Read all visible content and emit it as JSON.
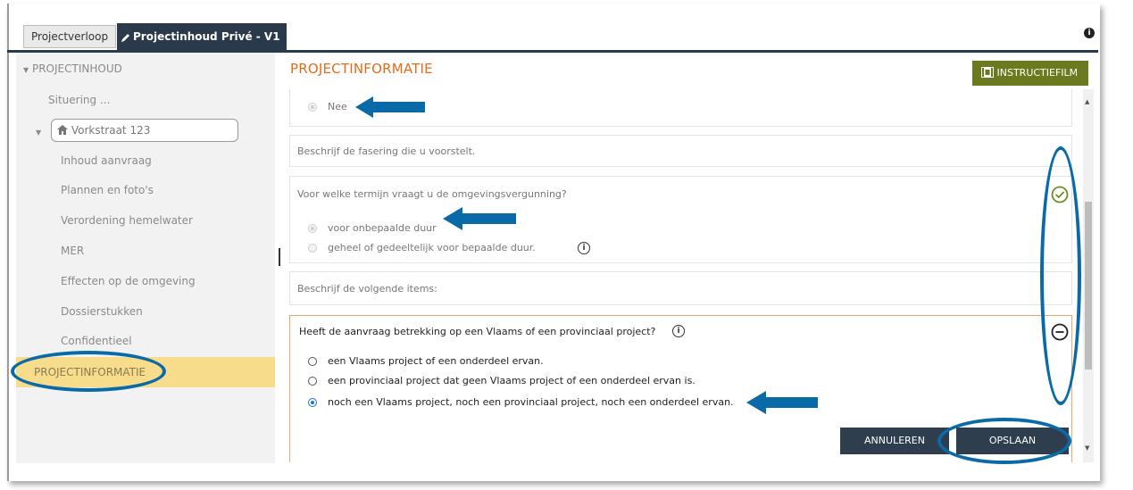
{
  "tabs": {
    "tab1": "Projectverloop",
    "tab2": "Projectinhoud Privé - V1"
  },
  "sidebar": {
    "root": "PROJECTINHOUD",
    "situering": "Situering ...",
    "address": "Vorkstraat 123",
    "items": [
      "Inhoud aanvraag",
      "Plannen en foto's",
      "Verordening hemelwater",
      "MER",
      "Effecten op de omgeving",
      "Dossierstukken",
      "Confidentieel"
    ],
    "selected": "PROJECTINFORMATIE"
  },
  "main": {
    "title": "PROJECTINFORMATIE",
    "instruction_button": "INSTRUCTIEFILM",
    "nee_label": "Nee",
    "fasering_placeholder": "Beschrijf de fasering die u voorstelt.",
    "termijn_question": "Voor welke termijn vraagt u de omgevingsvergunning?",
    "termijn_opt1": "voor onbepaalde duur",
    "termijn_opt2": "geheel of gedeeltelijk voor bepaalde duur.",
    "items_label": "Beschrijf de volgende items:",
    "vlaams_question": "Heeft de aanvraag betrekking op een Vlaams of een provinciaal project?",
    "vlaams_opt1": "een Vlaams project of een onderdeel ervan.",
    "vlaams_opt2": "een provinciaal project dat geen Vlaams project of een onderdeel ervan is.",
    "vlaams_opt3": "noch een Vlaams project, noch een provinciaal project, noch een onderdeel ervan.",
    "cancel_button": "ANNULEREN",
    "save_button": "OPSLAAN"
  },
  "colors": {
    "accent": "#e36c1a",
    "annotation": "#0a6aa8",
    "selected": "#f7dc8c",
    "check": "#6b8e23"
  },
  "icons": [
    "pencil-icon",
    "info-icon",
    "home-icon",
    "film-icon",
    "check-circle-icon",
    "minus-circle-icon",
    "triangle-down-icon",
    "arrow-left-icon"
  ]
}
